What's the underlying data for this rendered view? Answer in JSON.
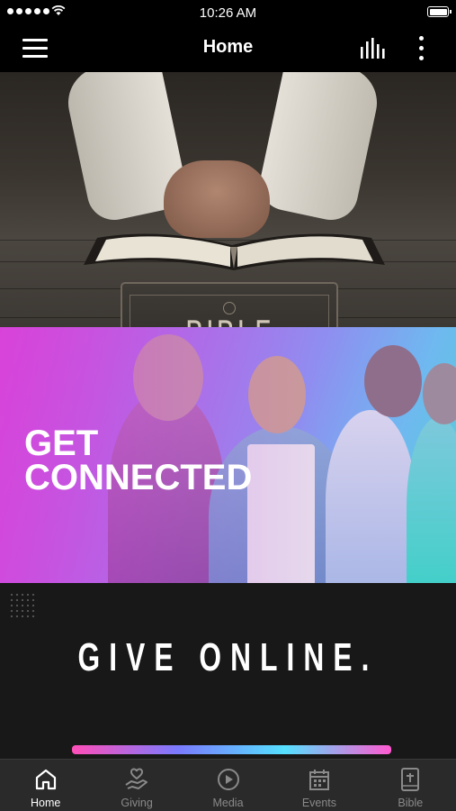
{
  "status_bar": {
    "time": "10:26 AM"
  },
  "header": {
    "title": "Home"
  },
  "banners": [
    {
      "text": "BIBLE STUDY"
    },
    {
      "line1": "GET",
      "line2": "CONNECTED"
    },
    {
      "text": "GIVE ONLINE."
    }
  ],
  "carousel": {
    "count": 4,
    "active_index": 0
  },
  "tabs": [
    {
      "label": "Home",
      "icon": "home-icon",
      "active": true
    },
    {
      "label": "Giving",
      "icon": "giving-hand-heart-icon",
      "active": false
    },
    {
      "label": "Media",
      "icon": "play-circle-icon",
      "active": false
    },
    {
      "label": "Events",
      "icon": "calendar-icon",
      "active": false
    },
    {
      "label": "Bible",
      "icon": "bible-book-icon",
      "active": false
    }
  ],
  "colors": {
    "active_tab": "#ffffff",
    "inactive_tab": "#8a8a8a",
    "tab_bar_bg": "#2a2a2a"
  }
}
